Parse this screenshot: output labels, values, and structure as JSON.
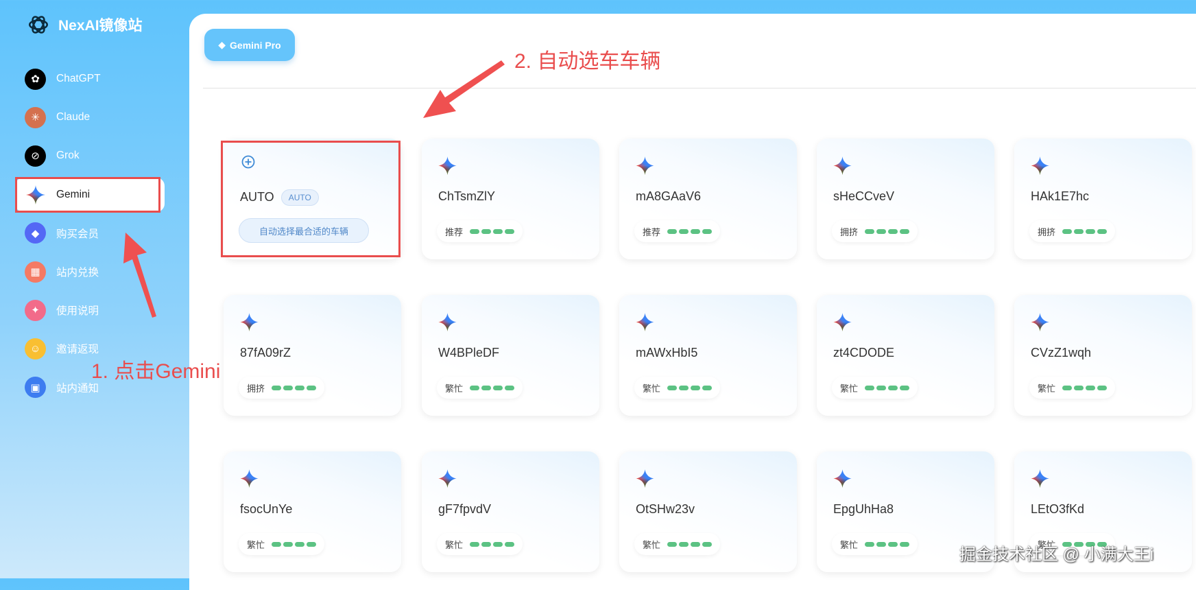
{
  "sidebar": {
    "brand": "NexAI镜像站",
    "items": [
      {
        "label": "ChatGPT",
        "icon": "chatgpt-icon",
        "color": "#000000"
      },
      {
        "label": "Claude",
        "icon": "claude-icon",
        "color": "#d4714f"
      },
      {
        "label": "Grok",
        "icon": "grok-icon",
        "color": "#000000"
      },
      {
        "label": "Gemini",
        "icon": "gemini-icon",
        "active": true
      },
      {
        "label": "购买会员",
        "icon": "diamond-icon",
        "color": "#5468f5"
      },
      {
        "label": "站内兑换",
        "icon": "gift-icon",
        "color": "#f47a64"
      },
      {
        "label": "使用说明",
        "icon": "book-icon",
        "color": "#f26b8a"
      },
      {
        "label": "邀请返现",
        "icon": "invite-icon",
        "color": "#f9bf32"
      },
      {
        "label": "站内通知",
        "icon": "notice-icon",
        "color": "#3d7cf0"
      }
    ]
  },
  "header": {
    "model_button": "Gemini Pro"
  },
  "auto_card": {
    "title": "AUTO",
    "badge": "AUTO",
    "description": "自动选择最合适的车辆"
  },
  "cars": [
    {
      "name": "ChTsmZlY",
      "status": "推荐"
    },
    {
      "name": "mA8GAaV6",
      "status": "推荐"
    },
    {
      "name": "sHeCCveV",
      "status": "拥挤"
    },
    {
      "name": "HAk1E7hc",
      "status": "拥挤"
    },
    {
      "name": "87fA09rZ",
      "status": "拥挤"
    },
    {
      "name": "W4BPleDF",
      "status": "繁忙"
    },
    {
      "name": "mAWxHbI5",
      "status": "繁忙"
    },
    {
      "name": "zt4CDODE",
      "status": "繁忙"
    },
    {
      "name": "CVzZ1wqh",
      "status": "繁忙"
    },
    {
      "name": "fsocUnYe",
      "status": "繁忙"
    },
    {
      "name": "gF7fpvdV",
      "status": "繁忙"
    },
    {
      "name": "OtSHw23v",
      "status": "繁忙"
    },
    {
      "name": "EpgUhHa8",
      "status": "繁忙"
    },
    {
      "name": "LEtO3fKd",
      "status": "繁忙"
    }
  ],
  "annotations": {
    "step1": "1. 点击Gemini",
    "step2": "2. 自动选车车辆"
  },
  "watermark": "掘金技术社区 @ 小满大王i",
  "colors": {
    "accent": "#65c4fb",
    "annotation": "#e94d4d",
    "status_bar": "#5cc283"
  }
}
